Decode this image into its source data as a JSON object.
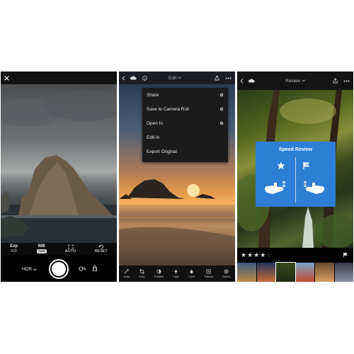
{
  "camera": {
    "controls": [
      {
        "label": "Exp",
        "value": "0.0"
      },
      {
        "label": "WB",
        "value": "AWB"
      },
      {
        "label": "",
        "value": "AUTO"
      },
      {
        "label": "",
        "value": "RESET"
      }
    ],
    "hdr_label": "HDR"
  },
  "edit": {
    "title": "Edit",
    "menu": [
      {
        "label": "Share"
      },
      {
        "label": "Save to Camera Roll"
      },
      {
        "label": "Open In"
      },
      {
        "label": "Edit In"
      },
      {
        "label": "Export Original"
      }
    ],
    "tools": [
      "Auto",
      "Crop",
      "Presets",
      "Light",
      "Color",
      "Effects",
      "Optics"
    ]
  },
  "review": {
    "title": "Review",
    "speed_review_title": "Speed Review",
    "rating": 4,
    "max_rating": 5
  },
  "colors": {
    "speed_review_bg": "#2d7fd6",
    "accent_menu_bg": "#1b1b1b"
  }
}
